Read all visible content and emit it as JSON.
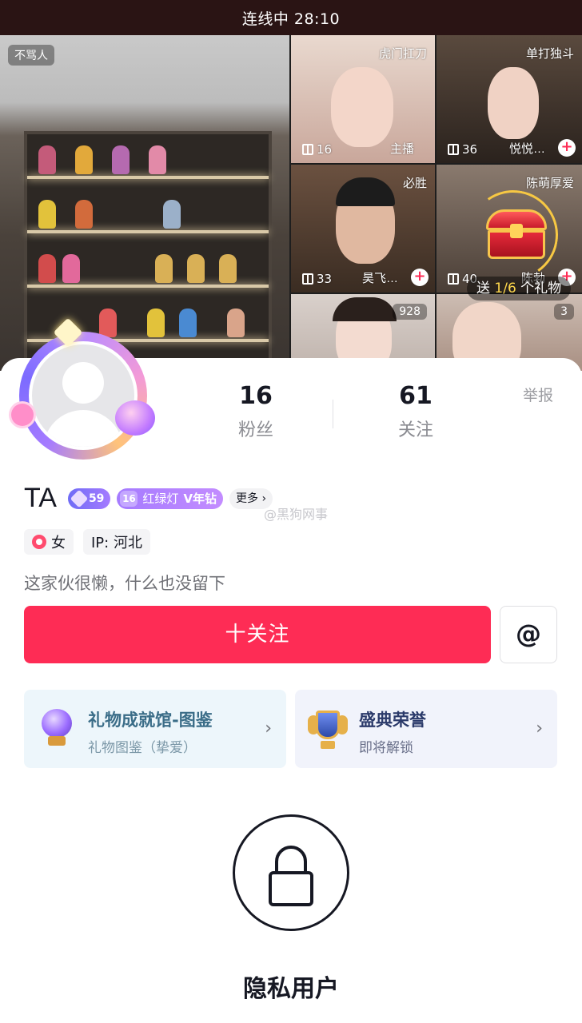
{
  "topbar": {
    "status": "连线中 28:10"
  },
  "live": {
    "main_tag": "不骂人",
    "tiles": [
      {
        "label": "虎门扛刀",
        "count": "16",
        "name": "主播"
      },
      {
        "label": "单打独斗",
        "count": "36",
        "name": "悦悦…"
      },
      {
        "label": "必胜",
        "count": "33",
        "name": "昊飞…"
      },
      {
        "label": "陈萌厚爱",
        "count": "40",
        "name": "陈勃"
      },
      {
        "badge": "928"
      },
      {
        "badge": "3"
      }
    ],
    "send_prefix": "送 ",
    "send_progress": "1/6",
    "send_suffix": " 个礼物"
  },
  "profile": {
    "fans_count": "16",
    "fans_label": "粉丝",
    "following_count": "61",
    "following_label": "关注",
    "report": "举报",
    "name": "TA",
    "level": "59",
    "fan_club_level": "16",
    "fan_club_name": "红绿灯",
    "fan_club_tier": "V年钻",
    "more": "更多 ›",
    "watermark": "@黑狗网事",
    "gender": "女",
    "ip": "IP: 河北",
    "bio": "这家伙很懒，什么也没留下",
    "follow_button": "十关注",
    "at_button": "@"
  },
  "cards": [
    {
      "title": "礼物成就馆-图鉴",
      "sub": "礼物图鉴（挚爱）"
    },
    {
      "title": "盛典荣誉",
      "sub": "即将解锁"
    }
  ],
  "private": {
    "label": "隐私用户",
    "icon": "lock-icon"
  },
  "colors": {
    "accent": "#fe2c55",
    "level_badge": "#6f6cf6",
    "fan_badge": "#a57bff"
  }
}
